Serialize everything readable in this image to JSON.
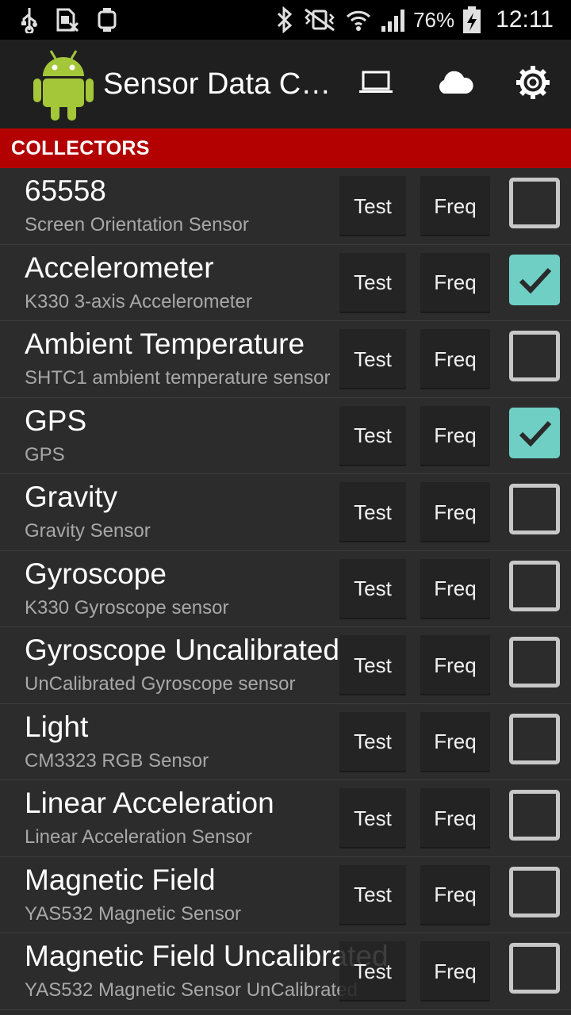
{
  "status_bar": {
    "battery_text": "76%",
    "time": "12:11"
  },
  "action_bar": {
    "title": "Sensor Data Collector",
    "actions": [
      "laptop-icon",
      "cloud-icon",
      "settings-icon"
    ]
  },
  "section": {
    "label": "COLLECTORS"
  },
  "colors": {
    "accent_red": "#b30000",
    "check_teal": "#6fcfc4",
    "background": "#2a2a2a"
  },
  "sensors": [
    {
      "name": "65558",
      "description": "Screen Orientation Sensor",
      "test_label": "Test",
      "freq_label": "Freq",
      "checked": false
    },
    {
      "name": "Accelerometer",
      "description": "K330 3-axis Accelerometer",
      "test_label": "Test",
      "freq_label": "Freq",
      "checked": true
    },
    {
      "name": "Ambient Temperature",
      "description": "SHTC1 ambient temperature sensor",
      "test_label": "Test",
      "freq_label": "Freq",
      "checked": false
    },
    {
      "name": "GPS",
      "description": "GPS",
      "test_label": "Test",
      "freq_label": "Freq",
      "checked": true
    },
    {
      "name": "Gravity",
      "description": "Gravity Sensor",
      "test_label": "Test",
      "freq_label": "Freq",
      "checked": false
    },
    {
      "name": "Gyroscope",
      "description": "K330 Gyroscope sensor",
      "test_label": "Test",
      "freq_label": "Freq",
      "checked": false
    },
    {
      "name": "Gyroscope Uncalibrated",
      "description": "UnCalibrated Gyroscope sensor",
      "test_label": "Test",
      "freq_label": "Freq",
      "checked": false
    },
    {
      "name": "Light",
      "description": "CM3323 RGB Sensor",
      "test_label": "Test",
      "freq_label": "Freq",
      "checked": false
    },
    {
      "name": "Linear Acceleration",
      "description": "Linear Acceleration Sensor",
      "test_label": "Test",
      "freq_label": "Freq",
      "checked": false
    },
    {
      "name": "Magnetic Field",
      "description": "YAS532 Magnetic Sensor",
      "test_label": "Test",
      "freq_label": "Freq",
      "checked": false
    },
    {
      "name": "Magnetic Field Uncalibrated",
      "description": "YAS532 Magnetic Sensor UnCalibrated",
      "test_label": "Test",
      "freq_label": "Freq",
      "checked": false
    }
  ]
}
